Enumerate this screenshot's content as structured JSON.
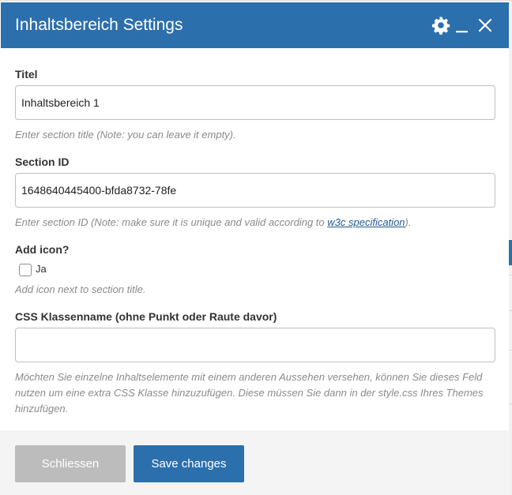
{
  "window": {
    "title": "Inhaltsbereich Settings",
    "icons": {
      "settings": "gear-icon",
      "minimize": "minimize-icon",
      "close": "close-icon"
    }
  },
  "fields": {
    "title": {
      "label": "Titel",
      "value": "Inhaltsbereich 1",
      "help": "Enter section title (Note: you can leave it empty)."
    },
    "section_id": {
      "label": "Section ID",
      "value": "1648640445400-bfda8732-78fe",
      "help_prefix": "Enter section ID (Note: make sure it is unique and valid according to ",
      "help_link": "w3c specification",
      "help_suffix": ")."
    },
    "add_icon": {
      "label": "Add icon?",
      "option_label": "Ja",
      "checked": false,
      "help": "Add icon next to section title."
    },
    "css_class": {
      "label": "CSS Klassenname (ohne Punkt oder Raute davor)",
      "value": "",
      "help": "Möchten Sie einzelne Inhaltselemente mit einem anderen Aussehen versehen, können Sie dieses Feld nutzen um eine extra CSS Klasse hinzuzufügen. Diese müssen Sie dann in der style.css Ihres Themes hinzufügen."
    }
  },
  "footer": {
    "close_label": "Schliessen",
    "save_label": "Save changes"
  },
  "colors": {
    "accent": "#2c6fad",
    "button_disabled": "#bcbcbc",
    "help_text": "#8a8a8a",
    "link": "#1f5a93"
  }
}
